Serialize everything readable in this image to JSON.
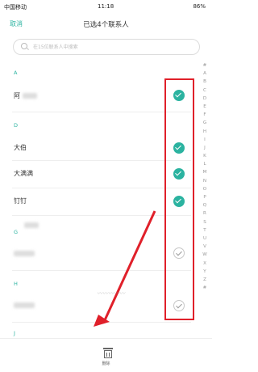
{
  "status_bar": {
    "carrier": "中国移动",
    "time": "11:18",
    "battery": "86%"
  },
  "header": {
    "cancel_label": "取消",
    "title": "已选4个联系人"
  },
  "search": {
    "placeholder": "在15位联系人中搜索"
  },
  "sections": [
    {
      "letter": "A"
    },
    {
      "letter": "D"
    },
    {
      "letter": "G"
    },
    {
      "letter": "H"
    },
    {
      "letter": "J"
    }
  ],
  "contacts": [
    {
      "name": "阿",
      "selected": true
    },
    {
      "name": "大伯",
      "selected": true
    },
    {
      "name": "大满满",
      "selected": true
    },
    {
      "name": "钉钉",
      "selected": true
    },
    {
      "name": "",
      "selected": false
    },
    {
      "name": "",
      "selected": false
    }
  ],
  "index_letters": [
    "#",
    "A",
    "B",
    "C",
    "D",
    "E",
    "F",
    "G",
    "H",
    "I",
    "J",
    "K",
    "L",
    "M",
    "N",
    "O",
    "P",
    "Q",
    "R",
    "S",
    "T",
    "U",
    "V",
    "W",
    "X",
    "Y",
    "Z",
    "#"
  ],
  "bottom": {
    "delete_label": "删除"
  },
  "colors": {
    "accent": "#2bb3a0",
    "highlight": "#e0202a"
  }
}
